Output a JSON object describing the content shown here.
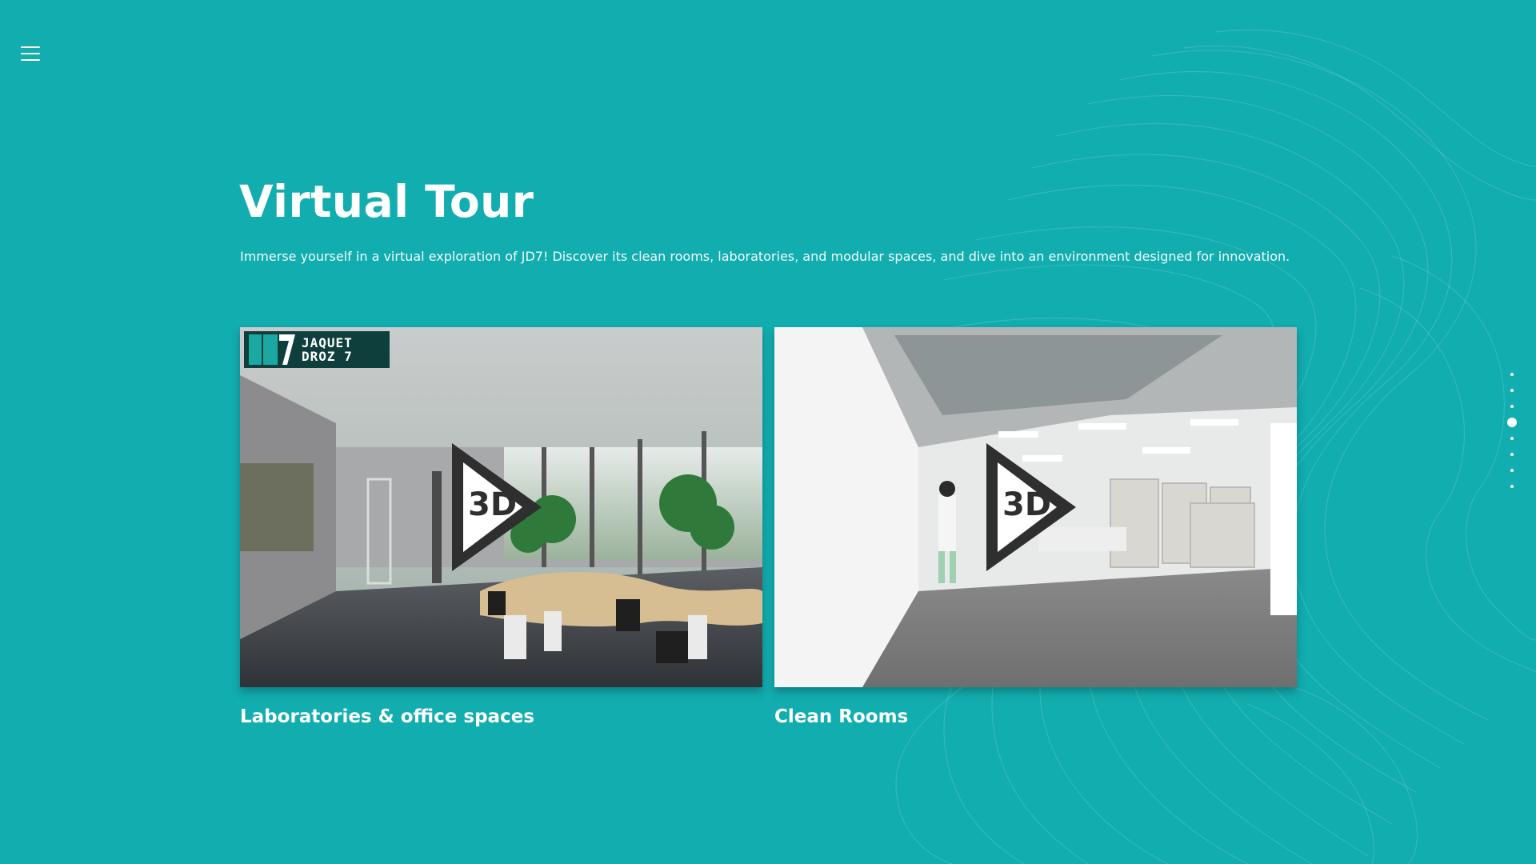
{
  "nav": {
    "menu_icon": "hamburger-menu-icon"
  },
  "hero": {
    "title": "Virtual Tour",
    "intro": "Immerse yourself in a virtual exploration of JD7! Discover its clean rooms, laboratories, and modular spaces, and dive into an environment designed for innovation."
  },
  "tours": [
    {
      "caption": "Laboratories & office spaces",
      "badge": "3D",
      "logo_line1": "JAQUET",
      "logo_line2": "DROZ 7",
      "icon": "3d-play-icon"
    },
    {
      "caption": "Clean Rooms",
      "badge": "3D",
      "icon": "3d-play-icon"
    }
  ],
  "section_nav": {
    "count": 8,
    "active_index": 3
  },
  "colors": {
    "background": "#12adaf",
    "text": "#ffffff",
    "logo_bg": "#0f3f3c",
    "logo_accent": "#1ba8a2"
  }
}
